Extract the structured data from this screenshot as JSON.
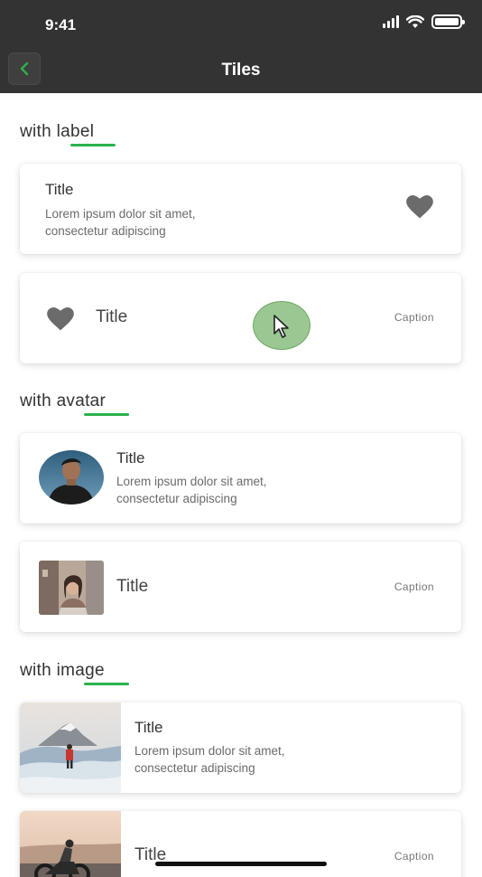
{
  "status": {
    "time": "9:41"
  },
  "nav": {
    "title": "Tiles",
    "back_icon": "chevron-left-icon",
    "accent": "#2bb24c",
    "bar_color": "#333333"
  },
  "sections": {
    "label": {
      "heading": "with label"
    },
    "avatar": {
      "heading": "with avatar"
    },
    "image": {
      "heading": "with image"
    }
  },
  "tiles": {
    "label_1": {
      "title": "Title",
      "subtitle_line1": "Lorem ipsum dolor sit amet,",
      "subtitle_line2": "consectetur adipiscing",
      "icon": "heart-icon"
    },
    "label_2": {
      "title": "Title",
      "caption": "Caption",
      "icon": "heart-icon"
    },
    "avatar_1": {
      "title": "Title",
      "subtitle_line1": "Lorem ipsum dolor sit amet,",
      "subtitle_line2": "consectetur adipiscing"
    },
    "avatar_2": {
      "title": "Title",
      "caption": "Caption"
    },
    "image_1": {
      "title": "Title",
      "subtitle_line1": "Lorem ipsum dolor sit amet,",
      "subtitle_line2": "consectetur adipiscing"
    },
    "image_2": {
      "title": "Title",
      "caption": "Caption"
    }
  }
}
